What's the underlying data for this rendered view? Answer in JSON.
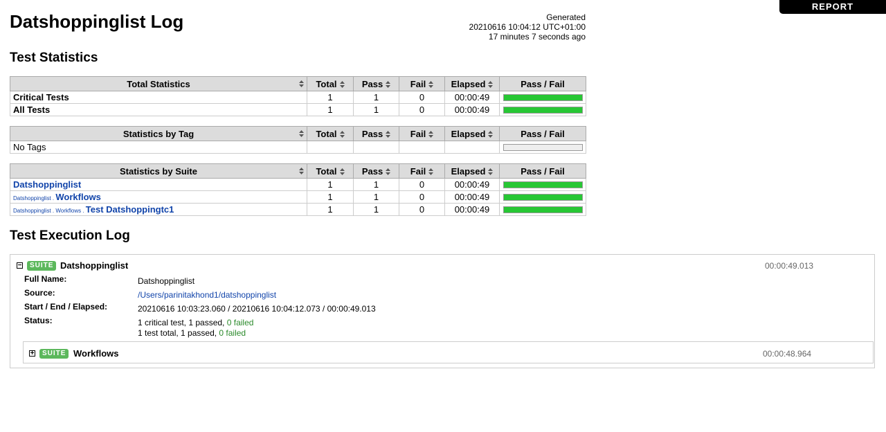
{
  "header": {
    "title": "Datshoppinglist Log",
    "generated_label": "Generated",
    "generated_timestamp": "20210616 10:04:12 UTC+01:00",
    "generated_ago": "17 minutes 7 seconds ago",
    "report_link": "REPORT"
  },
  "sections": {
    "test_statistics": "Test Statistics",
    "test_execution_log": "Test Execution Log"
  },
  "columns": {
    "total": "Total",
    "pass": "Pass",
    "fail": "Fail",
    "elapsed": "Elapsed",
    "pass_fail": "Pass / Fail"
  },
  "total_stats": {
    "header": "Total Statistics",
    "rows": [
      {
        "name": "Critical Tests",
        "total": "1",
        "pass": "1",
        "fail": "0",
        "elapsed": "00:00:49",
        "pass_ratio": 1.0
      },
      {
        "name": "All Tests",
        "total": "1",
        "pass": "1",
        "fail": "0",
        "elapsed": "00:00:49",
        "pass_ratio": 1.0
      }
    ]
  },
  "tag_stats": {
    "header": "Statistics by Tag",
    "rows": [
      {
        "name": "No Tags",
        "total": "",
        "pass": "",
        "fail": "",
        "elapsed": "",
        "pass_ratio": 0
      }
    ]
  },
  "suite_stats": {
    "header": "Statistics by Suite",
    "rows": [
      {
        "parent": "",
        "name": "Datshoppinglist",
        "total": "1",
        "pass": "1",
        "fail": "0",
        "elapsed": "00:00:49",
        "pass_ratio": 1.0
      },
      {
        "parent": "Datshoppinglist . ",
        "name": "Workflows",
        "total": "1",
        "pass": "1",
        "fail": "0",
        "elapsed": "00:00:49",
        "pass_ratio": 1.0
      },
      {
        "parent": "Datshoppinglist . Workflows . ",
        "name": "Test Datshoppingtc1",
        "total": "1",
        "pass": "1",
        "fail": "0",
        "elapsed": "00:00:49",
        "pass_ratio": 1.0
      }
    ]
  },
  "log": {
    "root_suite": {
      "badge": "SUITE",
      "name": "Datshoppinglist",
      "elapsed": "00:00:49.013",
      "toggle": "−",
      "labels": {
        "full_name": "Full Name:",
        "source": "Source:",
        "start_end": "Start / End / Elapsed:",
        "status": "Status:"
      },
      "full_name": "Datshoppinglist",
      "source": "/Users/parinitakhond1/datshoppinglist",
      "start_end": "20210616 10:03:23.060 / 20210616 10:04:12.073 / 00:00:49.013",
      "status_line1_prefix": "1 critical test, 1 passed, ",
      "status_line1_failed": "0 failed",
      "status_line2_prefix": "1 test total, 1 passed, ",
      "status_line2_failed": "0 failed"
    },
    "child_suite": {
      "badge": "SUITE",
      "name": "Workflows",
      "elapsed": "00:00:48.964",
      "toggle": "+"
    }
  },
  "colors": {
    "pass_bar": "#27c734",
    "suite_badge": "#5cb85c",
    "link": "#1144aa"
  }
}
